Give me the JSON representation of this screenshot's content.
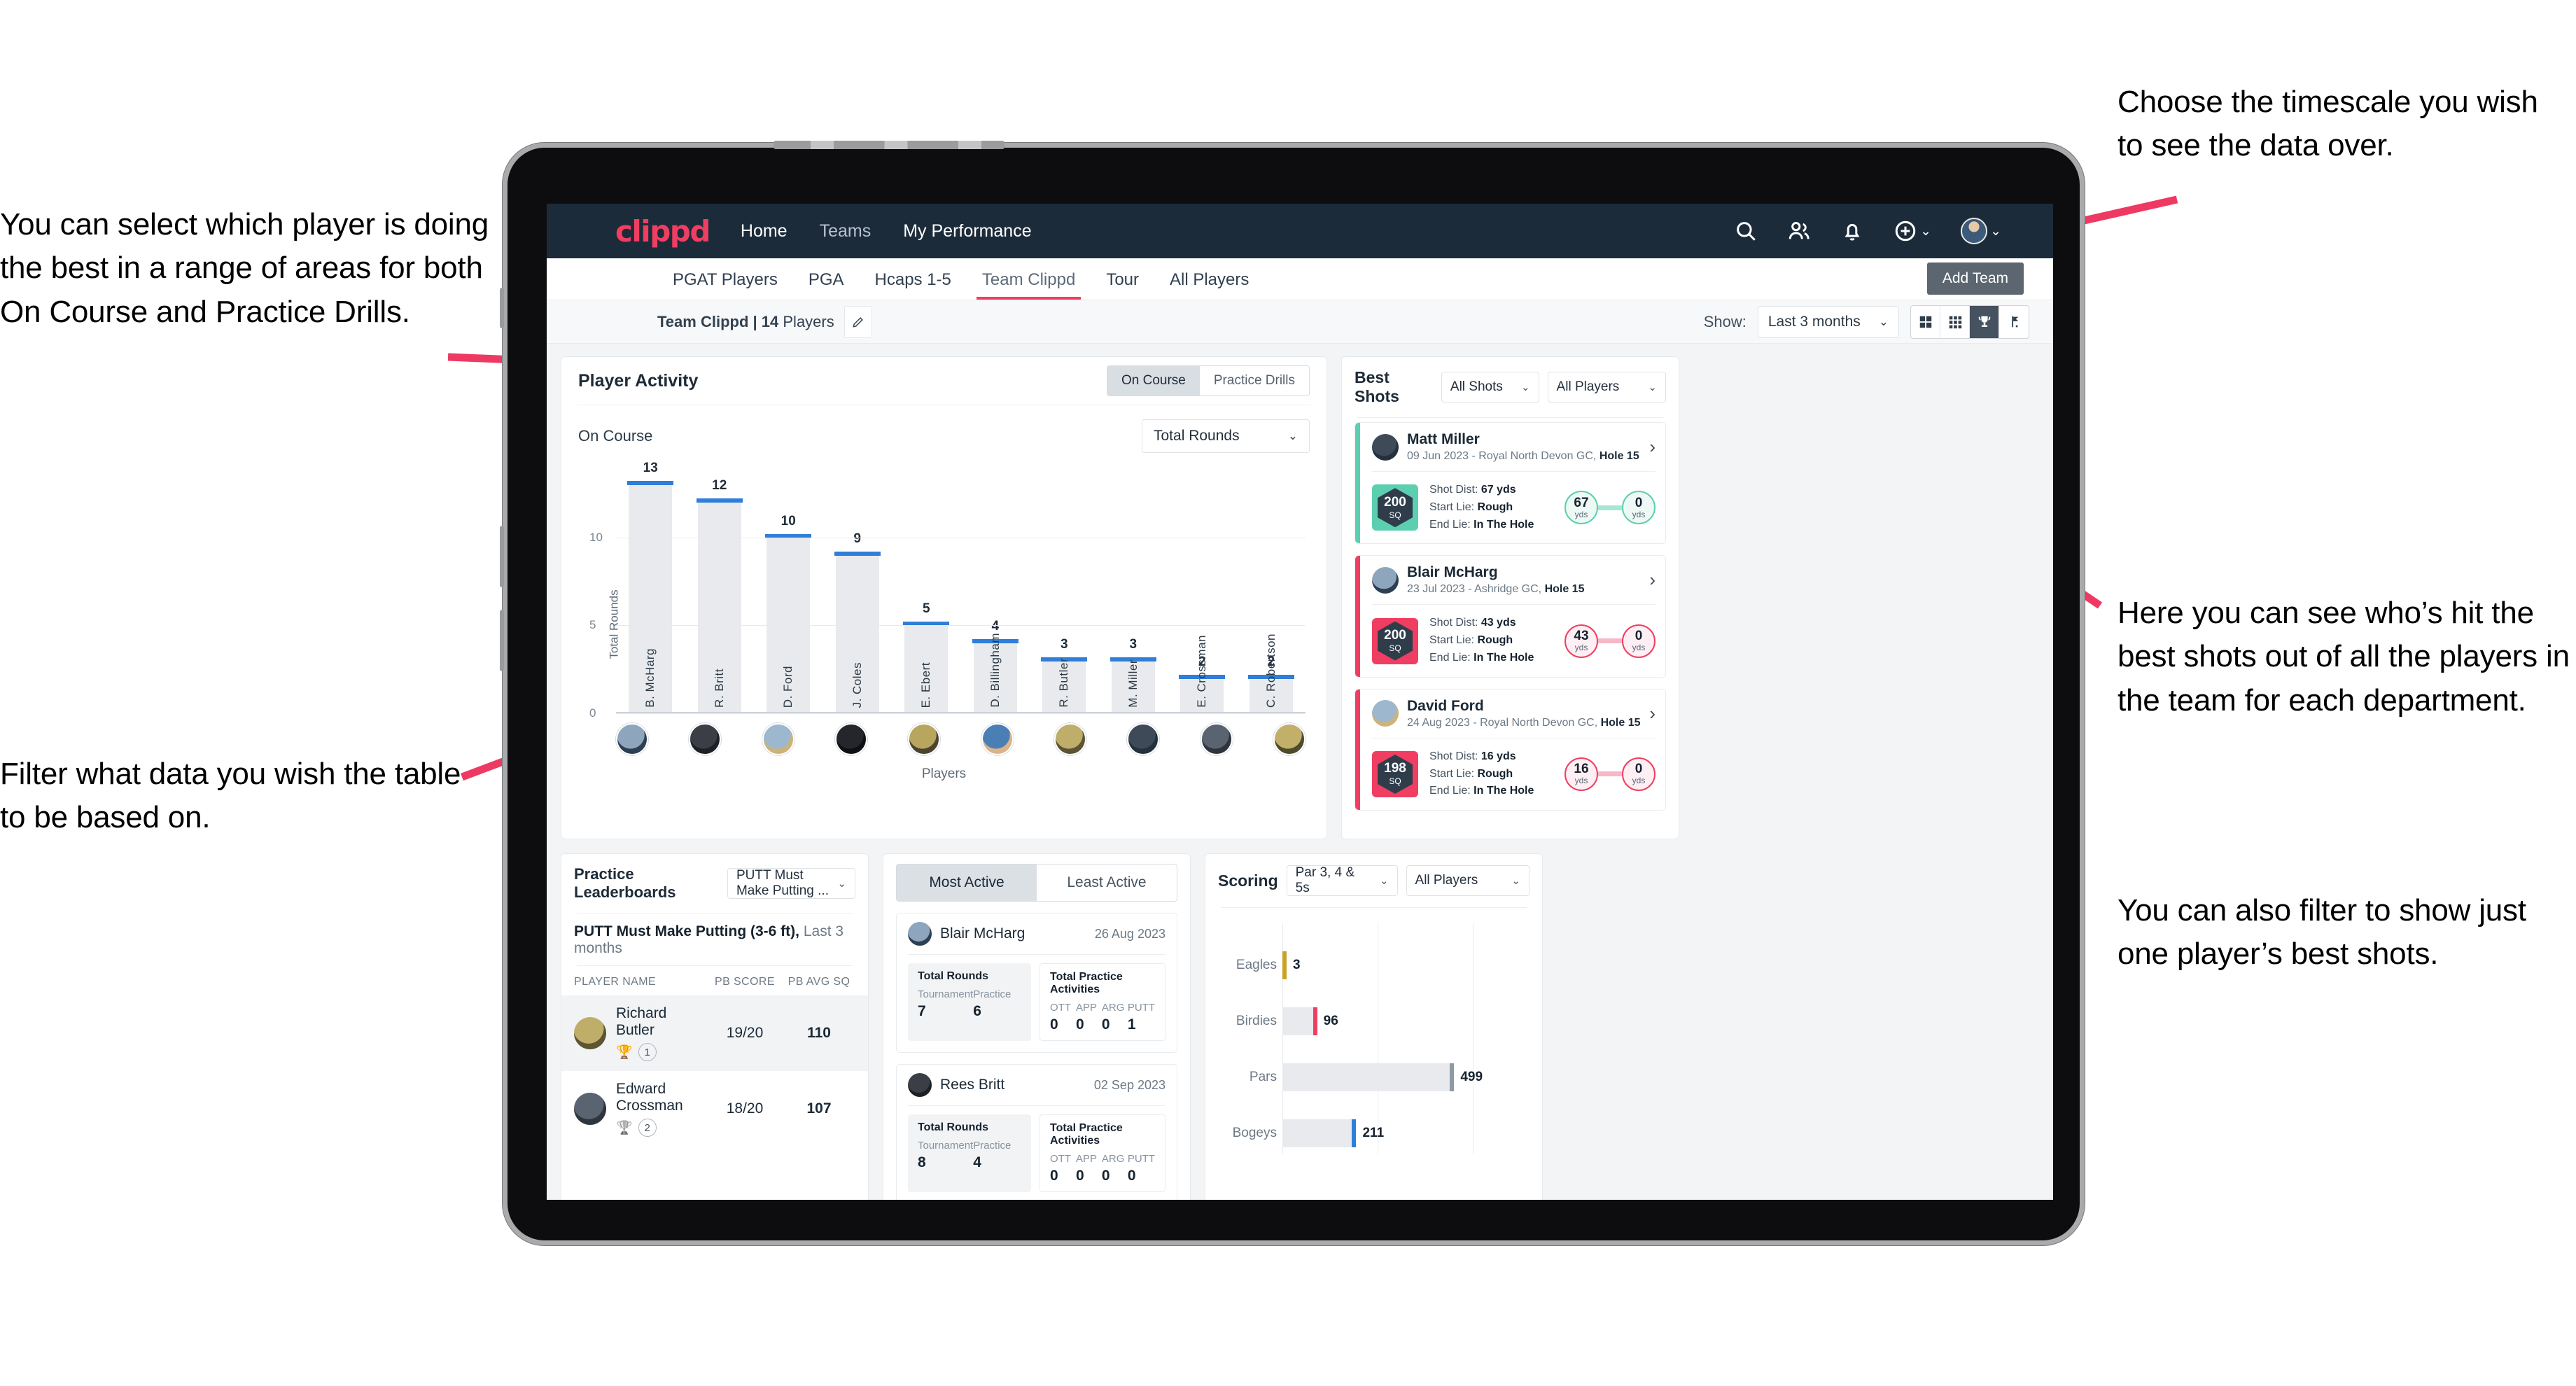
{
  "annotations": {
    "left_top": "You can select which player is doing the best in a range of areas for both On Course and Practice Drills.",
    "left_bottom": "Filter what data you wish the table to be based on.",
    "right_top": "Choose the timescale you wish to see the data over.",
    "right_mid": "Here you can see who’s hit the best shots out of all the players in the team for each department.",
    "right_bottom": "You can also filter to show just one player’s best shots."
  },
  "topnav": {
    "logo": "clippd",
    "links": [
      {
        "label": "Home",
        "active": true
      },
      {
        "label": "Teams",
        "active": false
      },
      {
        "label": "My Performance",
        "active": true
      }
    ],
    "icons": [
      "search-icon",
      "people-icon",
      "bell-icon",
      "plus-circle-icon",
      "avatar"
    ]
  },
  "tabs": [
    {
      "label": "PGAT Players",
      "active": false
    },
    {
      "label": "PGA",
      "active": false
    },
    {
      "label": "Hcaps 1-5",
      "active": false
    },
    {
      "label": "Team Clippd",
      "active": true
    },
    {
      "label": "Tour",
      "active": false
    },
    {
      "label": "All Players",
      "active": false
    }
  ],
  "subbar": {
    "team_name": "Team Clippd",
    "separator": " | ",
    "player_count": "14",
    "players_word": " Players",
    "show_label": "Show:",
    "timescale_value": "Last 3 months",
    "add_team_label": "Add Team",
    "view_icons": [
      "grid-2x2-icon",
      "grid-3x3-icon",
      "trophy-icon",
      "golf-flag-icon"
    ],
    "active_view_index": 2
  },
  "player_activity": {
    "title": "Player Activity",
    "segments": [
      {
        "label": "On Course",
        "active": true
      },
      {
        "label": "Practice Drills",
        "active": false
      }
    ],
    "sub_label": "On Course",
    "metric_select": "Total Rounds"
  },
  "chart_data": [
    {
      "type": "bar",
      "title": "Player Activity",
      "xlabel": "Players",
      "ylabel": "Total Rounds",
      "ylim": [
        0,
        14
      ],
      "yticks": [
        0,
        5,
        10
      ],
      "grid": true,
      "categories": [
        "B. McHarg",
        "R. Britt",
        "D. Ford",
        "J. Coles",
        "E. Ebert",
        "D. Billingham",
        "R. Butler",
        "M. Miller",
        "E. Crossman",
        "C. Robertson"
      ],
      "values": [
        13,
        12,
        10,
        9,
        5,
        4,
        3,
        3,
        2,
        2
      ]
    },
    {
      "type": "bar",
      "orientation": "horizontal",
      "title": "Scoring",
      "xlabel": "",
      "ylabel": "",
      "xlim": [
        0,
        560
      ],
      "categories": [
        "Eagles",
        "Birdies",
        "Pars",
        "Bogeys"
      ],
      "values": [
        3,
        96,
        499,
        211
      ],
      "colors": [
        "#c9a227",
        "#ef3e61",
        "#8e9aa6",
        "#2f7ed8"
      ]
    }
  ],
  "best_shots": {
    "title": "Best Shots",
    "shot_filter": "All Shots",
    "player_filter": "All Players",
    "cards": [
      {
        "name": "Matt Miller",
        "meta_date": "09 Jun 2023 - Royal North Devon GC, ",
        "meta_hole": "Hole 15",
        "score": "200",
        "score_unit": "SQ",
        "accent": "teal",
        "shot_dist_label": "Shot Dist: ",
        "shot_dist": "67 yds",
        "start_lie_label": "Start Lie: ",
        "start_lie": "Rough",
        "end_lie_label": "End Lie: ",
        "end_lie": "In The Hole",
        "from_value": "67",
        "from_unit": "yds",
        "to_value": "0",
        "to_unit": "yds"
      },
      {
        "name": "Blair McHarg",
        "meta_date": "23 Jul 2023 - Ashridge GC, ",
        "meta_hole": "Hole 15",
        "score": "200",
        "score_unit": "SQ",
        "accent": "pink",
        "shot_dist_label": "Shot Dist: ",
        "shot_dist": "43 yds",
        "start_lie_label": "Start Lie: ",
        "start_lie": "Rough",
        "end_lie_label": "End Lie: ",
        "end_lie": "In The Hole",
        "from_value": "43",
        "from_unit": "yds",
        "to_value": "0",
        "to_unit": "yds"
      },
      {
        "name": "David Ford",
        "meta_date": "24 Aug 2023 - Royal North Devon GC, ",
        "meta_hole": "Hole 15",
        "score": "198",
        "score_unit": "SQ",
        "accent": "pink",
        "shot_dist_label": "Shot Dist: ",
        "shot_dist": "16 yds",
        "start_lie_label": "Start Lie: ",
        "start_lie": "Rough",
        "end_lie_label": "End Lie: ",
        "end_lie": "In The Hole",
        "from_value": "16",
        "from_unit": "yds",
        "to_value": "0",
        "to_unit": "yds"
      }
    ]
  },
  "practice_leaderboards": {
    "title": "Practice Leaderboards",
    "drill_select": "PUTT Must Make Putting ...",
    "subtitle_bold": "PUTT Must Make Putting (3-6 ft),",
    "subtitle_rest": " Last 3 months",
    "columns": [
      "PLAYER NAME",
      "PB SCORE",
      "PB AVG SQ"
    ],
    "rows": [
      {
        "name": "Richard Butler",
        "rank": "1",
        "medal": "gold",
        "pb_score": "19/20",
        "pb_avg_sq": "110"
      },
      {
        "name": "Edward Crossman",
        "rank": "2",
        "medal": "silver",
        "pb_score": "18/20",
        "pb_avg_sq": "107"
      }
    ]
  },
  "activity": {
    "tabs": [
      {
        "label": "Most Active",
        "active": true
      },
      {
        "label": "Least Active",
        "active": false
      }
    ],
    "cards": [
      {
        "name": "Blair McHarg",
        "date": "26 Aug 2023",
        "rounds_title": "Total Rounds",
        "rounds_cols": [
          "Tournament",
          "Practice"
        ],
        "rounds_vals": [
          "7",
          "6"
        ],
        "practice_title": "Total Practice Activities",
        "practice_cols": [
          "OTT",
          "APP",
          "ARG",
          "PUTT"
        ],
        "practice_vals": [
          "0",
          "0",
          "0",
          "1"
        ]
      },
      {
        "name": "Rees Britt",
        "date": "02 Sep 2023",
        "rounds_title": "Total Rounds",
        "rounds_cols": [
          "Tournament",
          "Practice"
        ],
        "rounds_vals": [
          "8",
          "4"
        ],
        "practice_title": "Total Practice Activities",
        "practice_cols": [
          "OTT",
          "APP",
          "ARG",
          "PUTT"
        ],
        "practice_vals": [
          "0",
          "0",
          "0",
          "0"
        ]
      }
    ]
  },
  "scoring": {
    "title": "Scoring",
    "par_filter": "Par 3, 4 & 5s",
    "player_filter": "All Players"
  },
  "colors": {
    "brand_pink": "#ef3e61",
    "nav_dark": "#1c2b3a",
    "bar_blue": "#2f7ed8",
    "teal": "#5ccfb0",
    "page_bg": "#f2f4f6"
  }
}
